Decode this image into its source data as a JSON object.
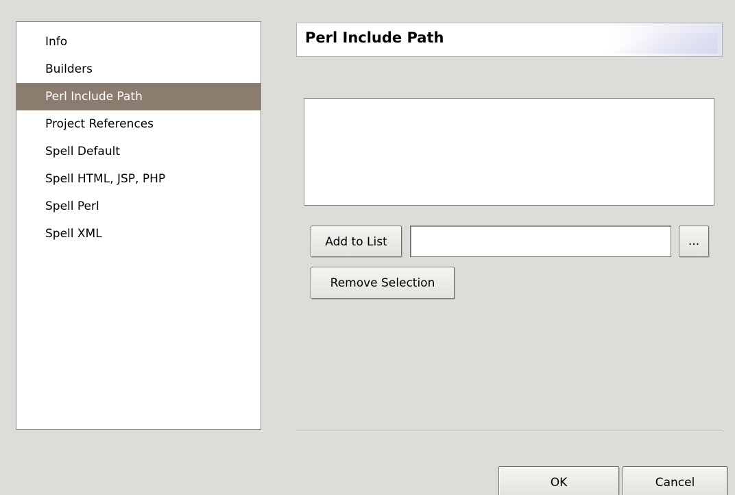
{
  "nav": {
    "items": [
      {
        "label": "Info"
      },
      {
        "label": "Builders"
      },
      {
        "label": "Perl Include Path",
        "selected": true
      },
      {
        "label": "Project References"
      },
      {
        "label": "Spell Default"
      },
      {
        "label": "Spell HTML, JSP, PHP"
      },
      {
        "label": "Spell Perl"
      },
      {
        "label": "Spell XML"
      }
    ]
  },
  "page": {
    "title": "Perl Include Path",
    "path_list_items": [],
    "add_to_list_label": "Add to List",
    "path_input_value": "",
    "browse_label": "...",
    "remove_selection_label": "Remove Selection"
  },
  "footer": {
    "ok_label": "OK",
    "cancel_label": "Cancel"
  },
  "colors": {
    "selection_bg": "#8a7d6f",
    "selection_fg": "#ffffff",
    "dialog_bg": "#dcdcd9"
  }
}
